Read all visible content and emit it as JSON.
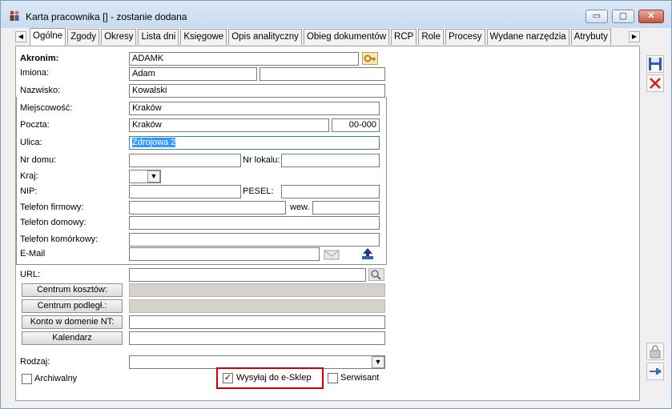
{
  "window": {
    "title": "Karta pracownika [] - zostanie dodana",
    "controls": {
      "minimize": "▭",
      "maximize": "▢",
      "close": "✕"
    }
  },
  "tabs": [
    "Ogólne",
    "Zgody",
    "Okresy",
    "Lista dni",
    "Księgowe",
    "Opis analityczny",
    "Obieg dokumentów",
    "RCP",
    "Role",
    "Procesy",
    "Wydane narzędzia",
    "Atrybuty"
  ],
  "form": {
    "akronim_label": "Akronim:",
    "akronim_value": "ADAMK",
    "imiona_label": "Imiona:",
    "imiona_value": "Adam",
    "imiona2_value": "",
    "nazwisko_label": "Nazwisko:",
    "nazwisko_value": "Kowalski",
    "miejscowosc_label": "Miejscowość:",
    "miejscowosc_value": "Kraków",
    "poczta_label": "Poczta:",
    "poczta_value": "Kraków",
    "kod_value": "00-000",
    "ulica_label": "Ulica:",
    "ulica_value": "Zdrojowa 2",
    "nr_domu_label": "Nr domu:",
    "nr_domu_value": "",
    "nr_lokalu_label": "Nr lokalu:",
    "nr_lokalu_value": "",
    "kraj_label": "Kraj:",
    "nip_label": "NIP:",
    "nip_value": "",
    "pesel_label": "PESEL:",
    "pesel_value": "",
    "tel_firmowy_label": "Telefon firmowy:",
    "tel_firmowy_value": "",
    "wew_label": "wew.",
    "wew_value": "",
    "tel_domowy_label": "Telefon domowy:",
    "tel_domowy_value": "",
    "tel_kom_label": "Telefon komórkowy:",
    "tel_kom_value": "",
    "email_label": "E-Mail",
    "email_value": "",
    "url_label": "URL:",
    "url_value": "",
    "centrum_kosztow_button": "Centrum kosztów:",
    "centrum_podlegl_button": "Centrum podległ.:",
    "konto_nt_button": "Konto w domenie NT:",
    "kalendarz_button": "Kalendarz",
    "rodzaj_label": "Rodzaj:",
    "rodzaj_value": "",
    "archiwalny_label": "Archiwalny",
    "archiwalny_checked": false,
    "wysylaj_label": "Wysyłaj do e-Sklep",
    "wysylaj_checked": true,
    "serwisant_label": "Serwisant",
    "serwisant_checked": false
  },
  "colors": {
    "highlight_border": "#d40000",
    "selection": "#3399ff",
    "disabled_field": "#d5d2cc"
  }
}
